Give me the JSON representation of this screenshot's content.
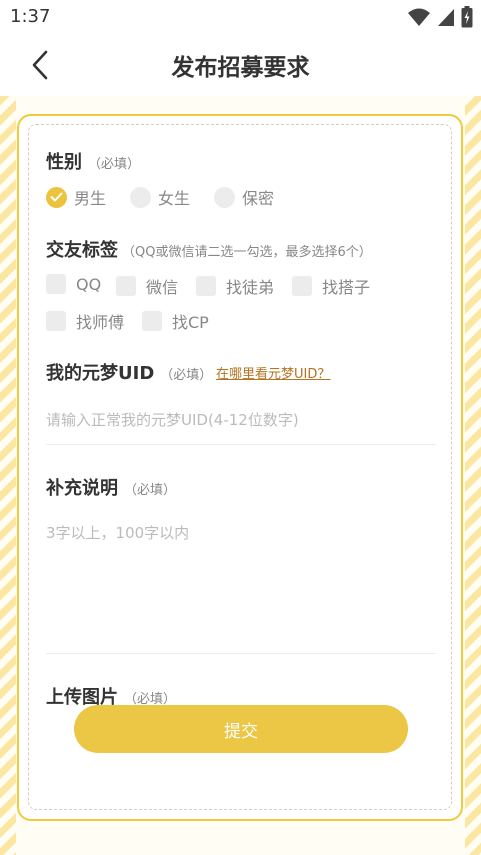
{
  "status_bar": {
    "time": "1:37",
    "wifi_icon": "wifi-icon",
    "signal_icon": "signal-icon",
    "battery_icon": "battery-icon"
  },
  "header": {
    "back_icon": "chevron-left-icon",
    "title": "发布招募要求"
  },
  "gender": {
    "title": "性别",
    "hint": "（必填）",
    "options": [
      {
        "label": "男生",
        "checked": true
      },
      {
        "label": "女生",
        "checked": false
      },
      {
        "label": "保密",
        "checked": false
      }
    ]
  },
  "tags": {
    "title": "交友标签",
    "hint": "（QQ或微信请二选一勾选，最多选择6个）",
    "options": [
      {
        "label": "QQ",
        "checked": false
      },
      {
        "label": "微信",
        "checked": false
      },
      {
        "label": "找徒弟",
        "checked": false
      },
      {
        "label": "找搭子",
        "checked": false
      },
      {
        "label": "找师傅",
        "checked": false
      },
      {
        "label": "找CP",
        "checked": false
      }
    ]
  },
  "uid": {
    "title": "我的元梦UID",
    "hint": "（必填）",
    "link": "在哪里看元梦UID？",
    "value": "",
    "placeholder": "请输入正常我的元梦UID(4-12位数字)"
  },
  "description": {
    "title": "补充说明",
    "hint": "（必填）",
    "value": "",
    "placeholder": "3字以上，100字以内"
  },
  "upload": {
    "title": "上传图片",
    "hint": "（必填）"
  },
  "submit_label": "提交",
  "colors": {
    "accent": "#ecc645",
    "stripe": "#fbe6a2",
    "link": "#b5721f"
  }
}
